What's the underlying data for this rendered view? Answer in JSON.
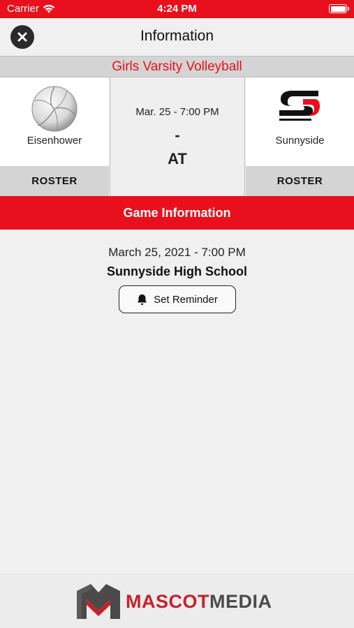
{
  "status_bar": {
    "carrier": "Carrier",
    "time": "4:24 PM"
  },
  "nav": {
    "title": "Information"
  },
  "sport": "Girls Varsity Volleyball",
  "matchup": {
    "home": {
      "name": "Eisenhower",
      "roster_label": "ROSTER"
    },
    "away": {
      "name": "Sunnyside",
      "roster_label": "ROSTER"
    },
    "date": "Mar. 25 - 7:00 PM",
    "score": "-",
    "at_label": "AT"
  },
  "game_info": {
    "header": "Game Information",
    "datetime": "March 25, 2021 - 7:00 PM",
    "venue": "Sunnyside High School",
    "reminder_label": "Set Reminder"
  },
  "footer": {
    "brand_red": "MASCOT",
    "brand_gray": "MEDIA"
  },
  "colors": {
    "accent": "#e8101c",
    "banner": "#d4d4d4",
    "background": "#f0f0f0"
  }
}
